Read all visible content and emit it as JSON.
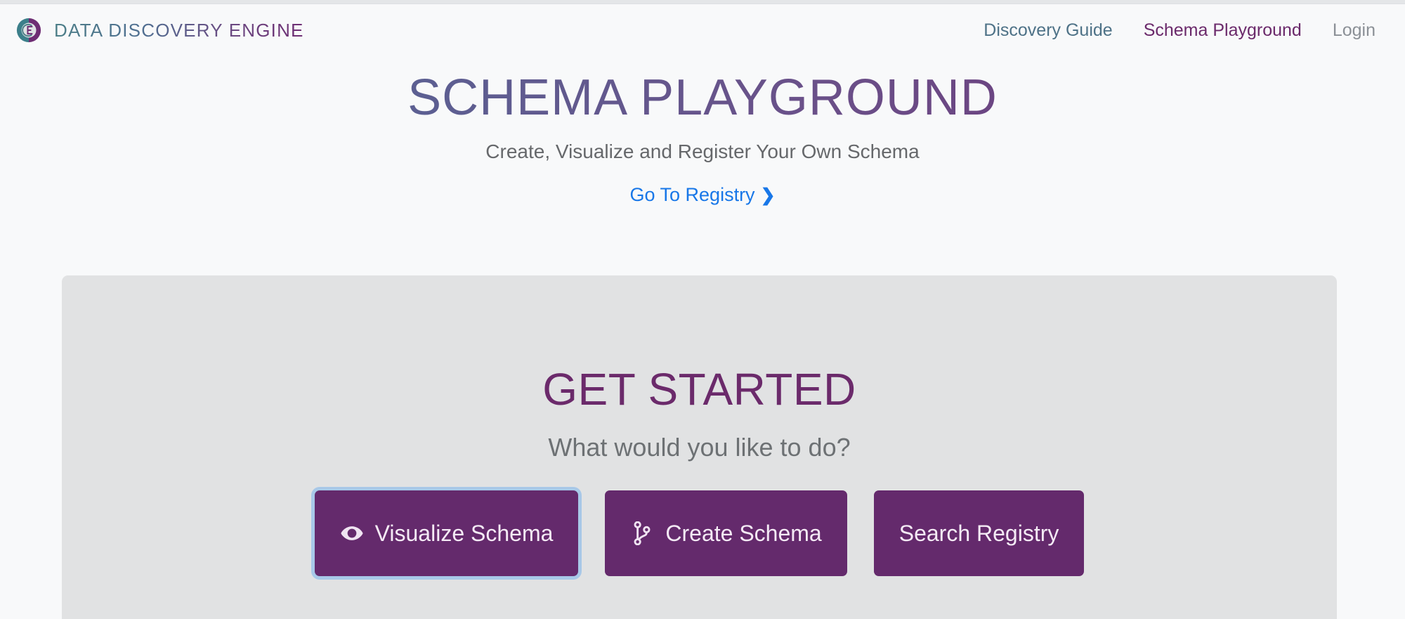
{
  "brand": {
    "logo_icon": "ddE-circle-logo-icon",
    "text": "DATA DISCOVERY ENGINE"
  },
  "nav": {
    "items": [
      {
        "label": "Discovery Guide",
        "state": "default"
      },
      {
        "label": "Schema Playground",
        "state": "active"
      },
      {
        "label": "Login",
        "state": "muted"
      }
    ]
  },
  "hero": {
    "title": "SCHEMA PLAYGROUND",
    "subtitle": "Create, Visualize and Register Your Own Schema",
    "link_label": "Go To Registry",
    "link_chevron": "❯"
  },
  "panel": {
    "title": "GET STARTED",
    "subtitle": "What would you like to do?",
    "buttons": [
      {
        "label": "Visualize Schema",
        "icon": "eye-icon",
        "focused": true
      },
      {
        "label": "Create Schema",
        "icon": "code-branch-icon",
        "focused": false
      },
      {
        "label": "Search Registry",
        "icon": "none",
        "focused": false
      }
    ]
  },
  "colors": {
    "page_bg": "#f8f9fa",
    "panel_bg": "#e1e2e3",
    "purple": "#642a6c",
    "teal": "#4d7f88",
    "link_blue": "#1877e8",
    "focus_ring": "#a8c8e8"
  }
}
